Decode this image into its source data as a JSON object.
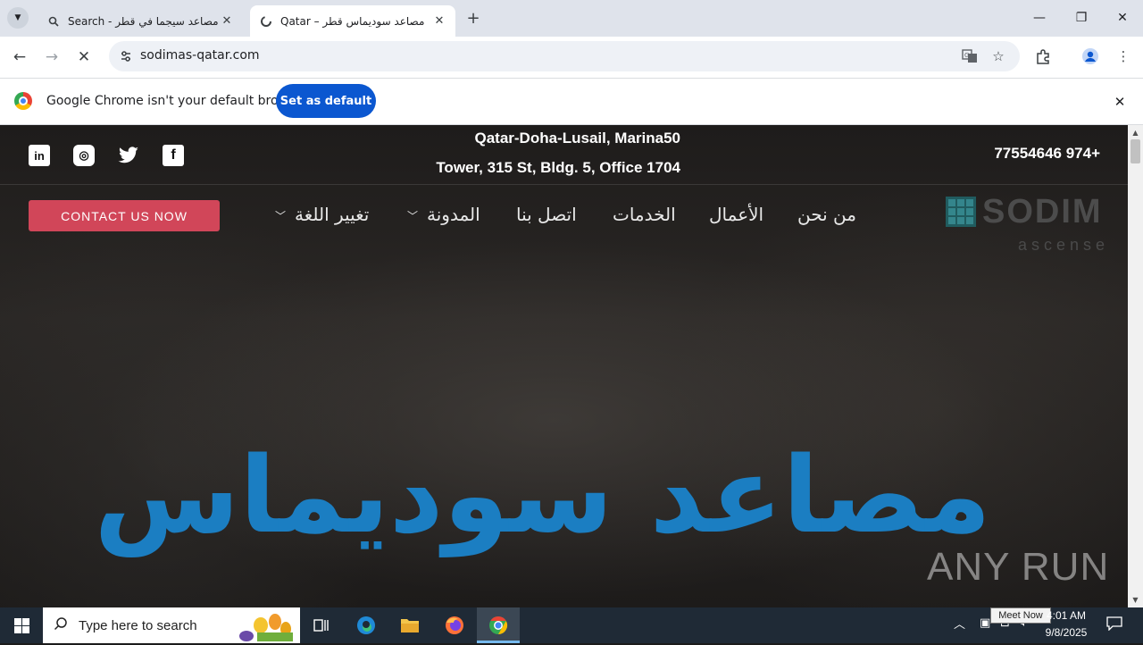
{
  "browser": {
    "tabs": [
      {
        "title": "Search - مصاعد سيجما في قطر",
        "icon": "search-icon",
        "active": false
      },
      {
        "title": "Qatar – مصاعد سوديماس قطر",
        "icon": "loading-spinner-icon",
        "active": true
      }
    ],
    "tab_search_icon": "chevron-down-icon",
    "new_tab_icon": "plus-icon",
    "window_controls": [
      "minimize-icon",
      "restore-icon",
      "close-icon"
    ],
    "url": "sodimas-qatar.com",
    "toolbar_icons": [
      "back-arrow-icon",
      "forward-arrow-icon",
      "stop-loading-icon",
      "site-info-icon",
      "translate-icon",
      "bookmark-star-icon",
      "extensions-icon",
      "profile-icon",
      "more-menu-icon"
    ],
    "infobar": {
      "text": "Google Chrome isn't your default browser",
      "button": "Set as default"
    }
  },
  "site": {
    "address_line1": "Qatar-Doha-Lusail, Marina50",
    "address_line2": "Tower, 315 St, Bldg. 5, Office 1704",
    "phone": "77554646 974+",
    "social_icons": [
      "linkedin-icon",
      "instagram-icon",
      "twitter-icon",
      "facebook-icon"
    ],
    "social_glyphs": {
      "linkedin": "in",
      "instagram": "◎",
      "twitter": "t",
      "facebook": "f"
    },
    "contact_button": "CONTACT US NOW",
    "nav": {
      "about": "من نحن",
      "works": "الأعمال",
      "services": "الخدمات",
      "contact": "اتصل بنا",
      "blog": "المدونة",
      "language": "تغيير اللغة"
    },
    "logo_text": "SODIM",
    "logo_sub": "ascense",
    "hero_title": "مصاعد سوديماس",
    "watermark": "ANY RUN"
  },
  "taskbar": {
    "search_placeholder": "Type here to search",
    "tooltip": "Meet Now",
    "time": "4:01 AM",
    "date": "9/8/2025",
    "pinned": [
      "task-view-icon",
      "edge-icon",
      "file-explorer-icon",
      "firefox-icon",
      "chrome-icon"
    ]
  },
  "colors": {
    "accent_blue": "#0b57d0",
    "hero_blue": "#1b7ec2",
    "contact_red": "#d14659",
    "taskbar": "#1f2a36"
  }
}
